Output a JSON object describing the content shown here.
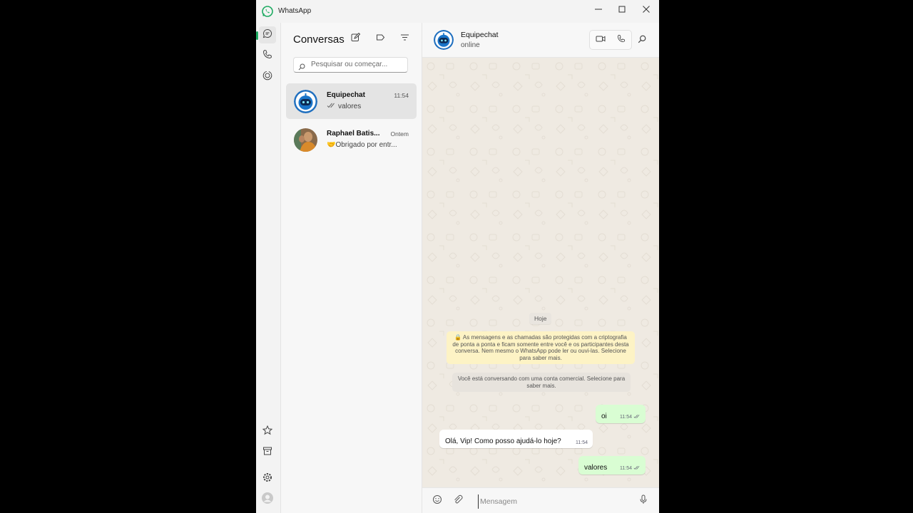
{
  "window": {
    "title": "WhatsApp"
  },
  "colors": {
    "accent": "#1daa61",
    "outgoing_bubble": "#d9fdd3",
    "chat_background": "#efeae2",
    "notice_background": "#fdf3c5"
  },
  "rail": {
    "top_items": [
      "chats-icon",
      "calls-icon",
      "status-icon"
    ],
    "bottom_items": [
      "starred-icon",
      "archive-icon",
      "settings-icon",
      "profile-avatar"
    ]
  },
  "list": {
    "title": "Conversas",
    "search_placeholder": "Pesquisar ou começar...",
    "chats": [
      {
        "name": "Equipechat",
        "time": "11:54",
        "preview": "valores",
        "selected": true
      },
      {
        "name": "Raphael Batis...",
        "time": "Ontem",
        "preview": "🤝Obrigado por entr...",
        "selected": false
      }
    ]
  },
  "conversation": {
    "name": "Equipechat",
    "status": "online",
    "date_chip": "Hoje",
    "encryption_notice": "🔒 As mensagens e as chamadas são protegidas com a criptografia de ponta a ponta e ficam somente entre você e os participantes desta conversa. Nem mesmo o WhatsApp pode ler ou ouvi-las. Selecione para saber mais.",
    "business_notice": "Você está conversando com uma conta comercial. Selecione para saber mais.",
    "messages": [
      {
        "direction": "out",
        "text": "oi",
        "time": "11:54"
      },
      {
        "direction": "in",
        "text": "Olá, Vip! Como posso ajudá-lo hoje?",
        "time": "11:54"
      },
      {
        "direction": "out",
        "text": "valores",
        "time": "11:54"
      }
    ],
    "composer_placeholder": "Mensagem"
  }
}
